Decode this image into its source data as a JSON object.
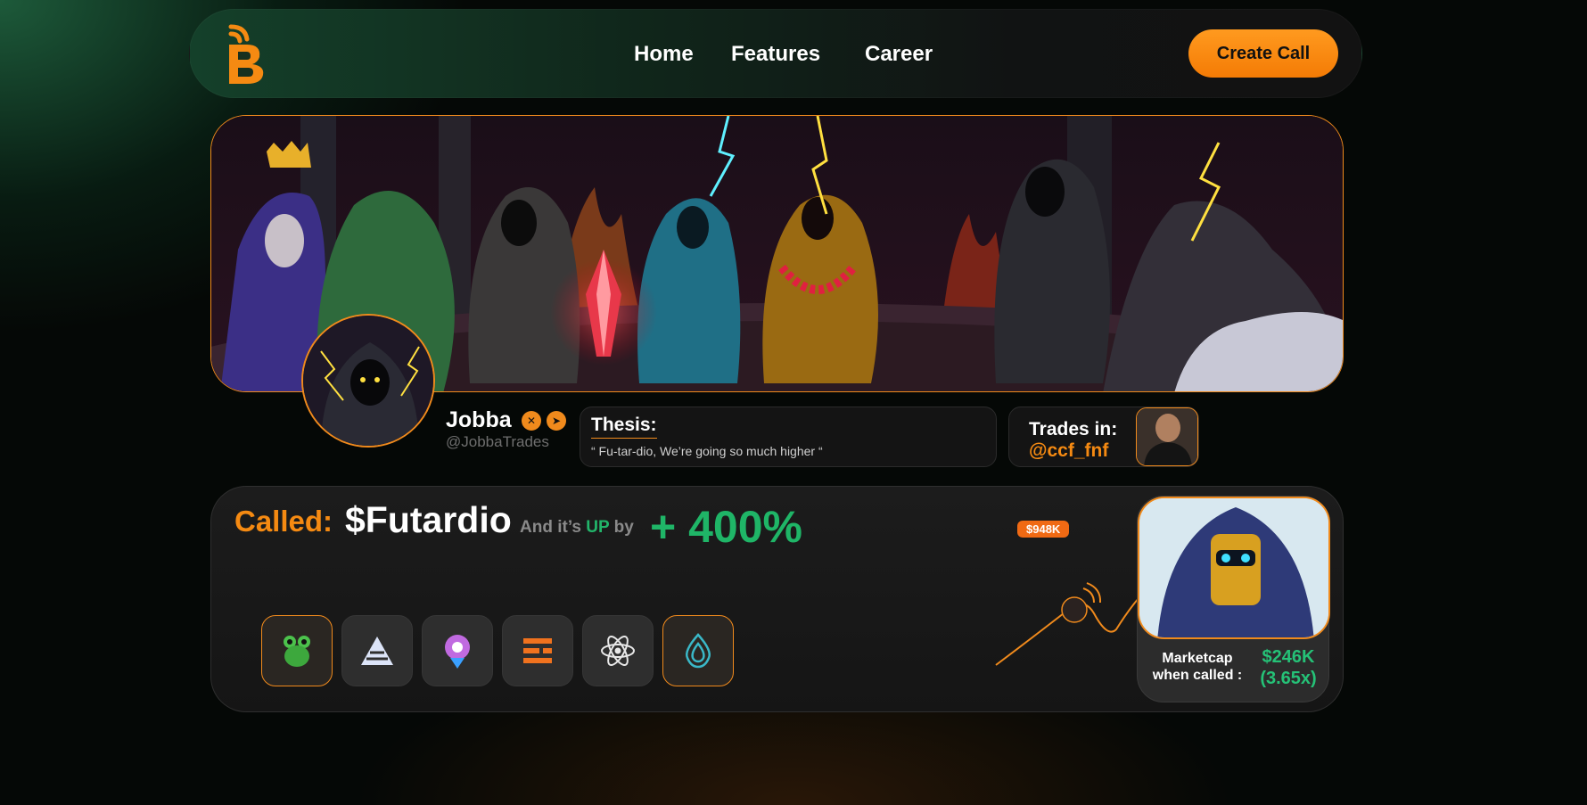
{
  "nav": {
    "logo": "B",
    "links": [
      "Home",
      "Features",
      "Career"
    ],
    "cta": "Create Call"
  },
  "profile": {
    "name": "Jobba",
    "handle": "@JobbaTrades",
    "social_icons": [
      "x-icon",
      "telegram-icon"
    ]
  },
  "thesis": {
    "label": "Thesis:",
    "text": "“ Fu-tar-dio, We’re going so much higher “"
  },
  "trades": {
    "label": "Trades in:",
    "handle": "@ccf_fnf"
  },
  "call": {
    "called_label": "Called:",
    "ticker": "$Futardio",
    "up_prefix": "And it’s",
    "up_word": "UP",
    "up_suffix": "by",
    "percent": "+ 400%",
    "peak_badge": "$948K",
    "marketcap_label_1": "Marketcap",
    "marketcap_label_2": "when called :",
    "marketcap_value": "$246K",
    "marketcap_multiple": "(3.65x)",
    "tools": [
      "frog-icon",
      "pyramid-icon",
      "rocket-icon",
      "bars-icon",
      "atom-icon",
      "drop-icon"
    ]
  },
  "colors": {
    "accent": "#f58a12",
    "positive": "#1fb567"
  }
}
